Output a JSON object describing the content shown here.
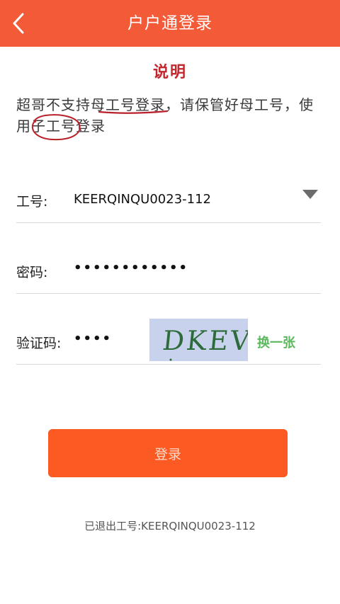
{
  "header": {
    "title": "户户通登录",
    "back_icon": "chevron-left-icon",
    "background": "#f25a38"
  },
  "notice": {
    "heading": "说明",
    "heading_color": "#c1272d",
    "segments": [
      {
        "text": "超哥不支持",
        "underline": false
      },
      {
        "text": "母工号登录",
        "underline": true
      },
      {
        "text": "，请保管好母工号，使用",
        "underline": false
      },
      {
        "text": "子工号",
        "circled": true
      },
      {
        "text": "登录",
        "underline": false
      }
    ]
  },
  "form": {
    "account": {
      "label": "工号:",
      "value": "KEERQINQU0023-112",
      "dropdown_icon": "caret-down-icon"
    },
    "password": {
      "label": "密码:",
      "value": "••••••••••••"
    },
    "captcha": {
      "label": "验证码:",
      "value": "••••",
      "image_text": "DKEV",
      "refresh_label": "换一张",
      "refresh_color": "#5cb85c"
    }
  },
  "login_button": {
    "label": "登录",
    "background": "#fb5a22"
  },
  "logout_note": "已退出工号:KEERQINQU0023-112"
}
